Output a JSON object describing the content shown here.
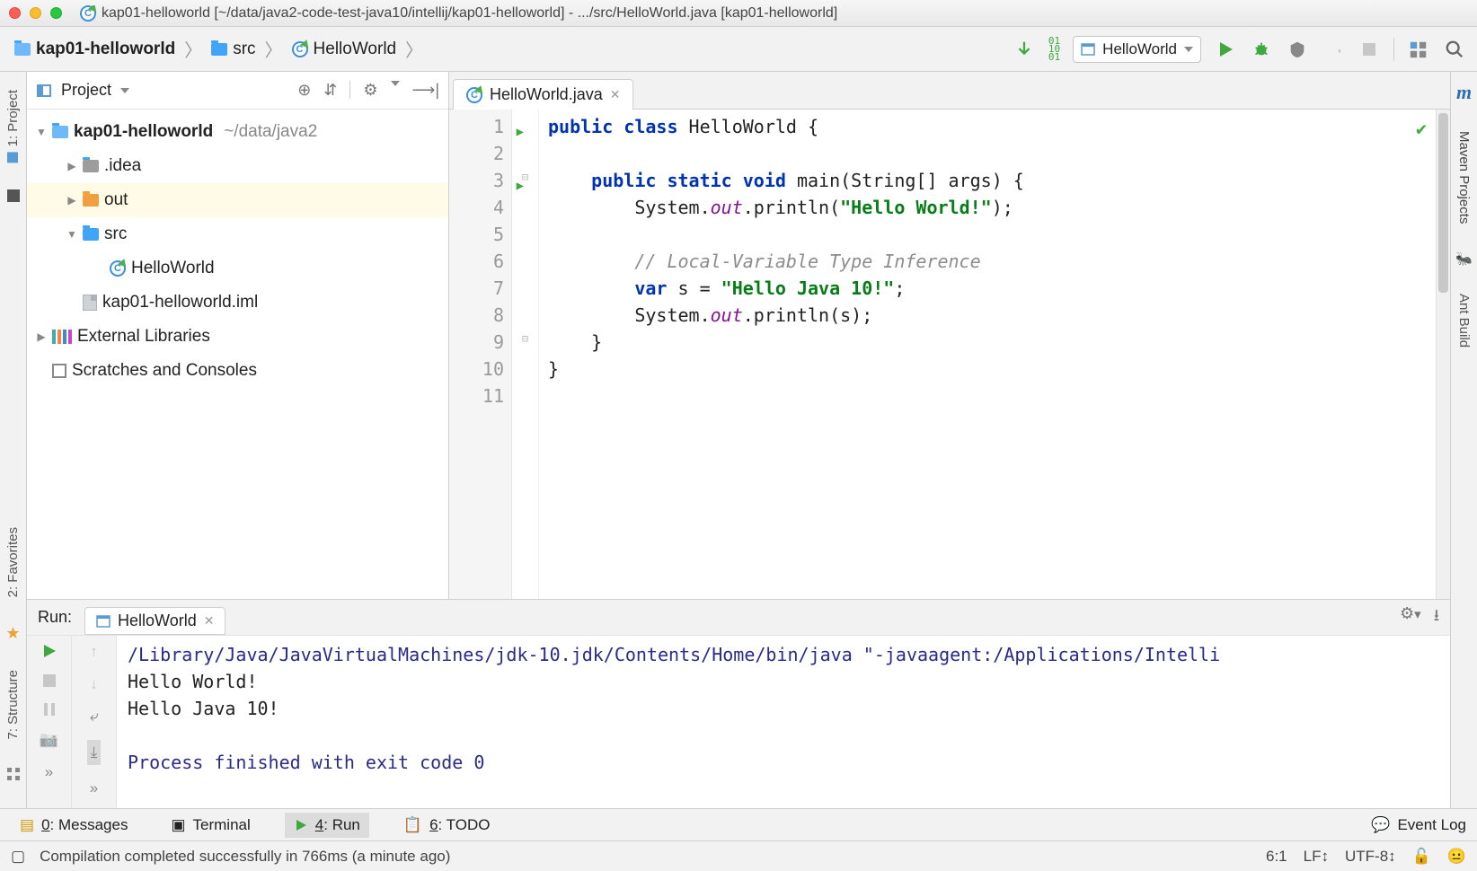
{
  "titlebar": {
    "title": "kap01-helloworld [~/data/java2-code-test-java10/intellij/kap01-helloworld] - .../src/HelloWorld.java [kap01-helloworld]"
  },
  "breadcrumb": {
    "root": "kap01-helloworld",
    "src": "src",
    "file": "HelloWorld"
  },
  "run_config": {
    "selected": "HelloWorld"
  },
  "left_tabs": {
    "project": "1: Project",
    "favorites": "2: Favorites",
    "structure": "7: Structure"
  },
  "right_tabs": {
    "maven": "Maven Projects",
    "ant": "Ant Build"
  },
  "project_panel": {
    "title": "Project",
    "tree": {
      "root": "kap01-helloworld",
      "root_path": "~/data/java2",
      "idea": ".idea",
      "out": "out",
      "src": "src",
      "hello": "HelloWorld",
      "iml": "kap01-helloworld.iml",
      "ext": "External Libraries",
      "scratch": "Scratches and Consoles"
    }
  },
  "editor": {
    "tab": "HelloWorld.java",
    "lines": {
      "l1a": "public",
      "l1b": "class",
      "l1c": " HelloWorld {",
      "l3a": "public",
      "l3b": "static",
      "l3c": "void",
      "l3d": " main(String[] args) {",
      "l4a": "System.",
      "l4b": "out",
      "l4c": ".println(",
      "l4d": "\"Hello World!\"",
      "l4e": ");",
      "l6": "// Local-Variable Type Inference",
      "l7a": "var",
      "l7b": " s = ",
      "l7c": "\"Hello Java 10!\"",
      "l7d": ";",
      "l8a": "System.",
      "l8b": "out",
      "l8c": ".println(s);",
      "l9": "}",
      "l10": "}"
    }
  },
  "run_panel": {
    "label": "Run:",
    "tab": "HelloWorld",
    "cmd": "/Library/Java/JavaVirtualMachines/jdk-10.jdk/Contents/Home/bin/java \"-javaagent:/Applications/Intelli",
    "out1": "Hello World!",
    "out2": "Hello Java 10!",
    "exit": "Process finished with exit code 0"
  },
  "bottom": {
    "messages": "0: Messages",
    "terminal": "Terminal",
    "run": "4: Run",
    "todo": "6: TODO",
    "eventlog": "Event Log"
  },
  "status": {
    "msg": "Compilation completed successfully in 766ms (a minute ago)",
    "pos": "6:1",
    "lf": "LF",
    "enc": "UTF-8"
  }
}
